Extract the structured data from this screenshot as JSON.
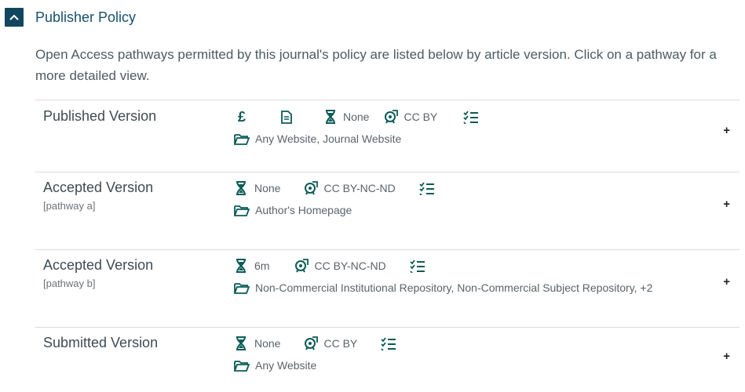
{
  "section": {
    "title": "Publisher Policy",
    "intro": "Open Access pathways permitted by this journal's policy are listed below by article version. Click on a pathway for a more detailed view."
  },
  "pathways": [
    {
      "version": "Published Version",
      "sub": "",
      "fee": "£",
      "embargo": "None",
      "license": "CC BY",
      "locations": "Any Website, Journal Website",
      "expand": "+"
    },
    {
      "version": "Accepted Version",
      "sub": "[pathway a]",
      "embargo": "None",
      "license": "CC BY-NC-ND",
      "locations": "Author's Homepage",
      "expand": "+"
    },
    {
      "version": "Accepted Version",
      "sub": "[pathway b]",
      "embargo": "6m",
      "license": "CC BY-NC-ND",
      "locations": "Non-Commercial Institutional Repository, Non-Commercial Subject Repository, +2",
      "expand": "+"
    },
    {
      "version": "Submitted Version",
      "sub": "",
      "embargo": "None",
      "license": "CC BY",
      "locations": "Any Website",
      "expand": "+"
    }
  ],
  "colors": {
    "header_bg": "#12465f",
    "icon": "#0b5b57",
    "title": "#16506e"
  }
}
